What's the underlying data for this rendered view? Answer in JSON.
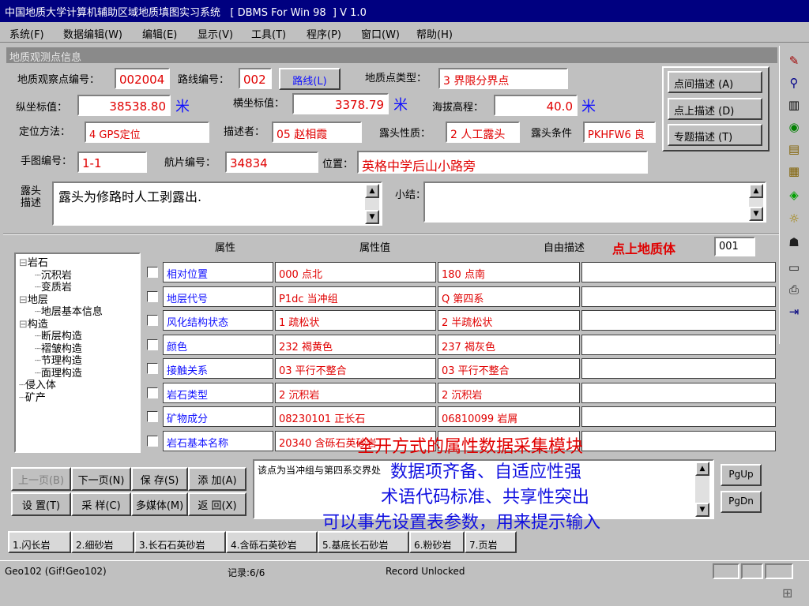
{
  "window": {
    "title": "中国地质大学计算机辅助区域地质填图实习系统   [ DBMS For Win 98  ] V 1.0"
  },
  "menu": [
    "系统(F)",
    "数据编辑(W)",
    "编辑(E)",
    "显示(V)",
    "工具(T)",
    "程序(P)",
    "窗口(W)",
    "帮助(H)"
  ],
  "panel": {
    "header": "地质观测点信息"
  },
  "form": {
    "point_no_label": "地质观察点编号：",
    "point_no": "002004",
    "route_no_label": "路线编号：",
    "route_no": "002",
    "route_button": "路线(L)",
    "point_type_label": "地质点类型：",
    "point_type": "3 界限分界点",
    "y_label": "纵坐标值：",
    "y_value": "38538.80",
    "y_unit": "米",
    "x_label": "横坐标值：",
    "x_value": "3378.79",
    "x_unit": "米",
    "alt_label": "海拔高程：",
    "alt_value": "40.0",
    "alt_unit": "米",
    "method_label": "定位方法：",
    "method": "4 GPS定位",
    "describer_label": "描述者：",
    "describer": "05 赵相霞",
    "outcrop_nature_label": "露头性质：",
    "outcrop_nature": "2 人工露头",
    "outcrop_cond_label": "露头条件",
    "outcrop_cond": "PKHFW6 良",
    "map_no_label": "手图编号：",
    "map_no": "1-1",
    "photo_no_label": "航片编号：",
    "photo_no": "34834",
    "location_label": "位置：",
    "location": "英格中学后山小路旁",
    "outcrop_desc_label": "露头描述",
    "outcrop_desc": "露头为修路时人工剥露出.",
    "summary_label": "小结："
  },
  "side_buttons": [
    "点间描述 (A)",
    "点上描述 (D)",
    "专题描述 (T)"
  ],
  "grid": {
    "headers": {
      "attr": "属性",
      "value": "属性值",
      "free": "自由描述"
    },
    "entity_label": "点上地质体",
    "entity_no": "001",
    "rows": [
      {
        "attr": "相对位置",
        "v1": "000 点北",
        "v2": "180 点南"
      },
      {
        "attr": "地层代号",
        "v1": "P1dc 当冲组",
        "v2": "Q 第四系"
      },
      {
        "attr": "风化结构状态",
        "v1": "1 疏松状",
        "v2": "2 半疏松状"
      },
      {
        "attr": "颜色",
        "v1": "232 褐黄色",
        "v2": "237 褐灰色"
      },
      {
        "attr": "接触关系",
        "v1": "03 平行不整合",
        "v2": "03 平行不整合"
      },
      {
        "attr": "岩石类型",
        "v1": "2 沉积岩",
        "v2": "2 沉积岩"
      },
      {
        "attr": "矿物成分",
        "v1": "08230101 正长石",
        "v2": "06810099 岩屑"
      },
      {
        "attr": "岩石基本名称",
        "v1": "20340 含砾石英砂岩",
        "v2": ""
      }
    ]
  },
  "tree": [
    {
      "text": "岩石",
      "level": 0,
      "exp": "−"
    },
    {
      "text": "沉积岩",
      "level": 1
    },
    {
      "text": "变质岩",
      "level": 1
    },
    {
      "text": "地层",
      "level": 0,
      "exp": "−"
    },
    {
      "text": "地层基本信息",
      "level": 1
    },
    {
      "text": "构造",
      "level": 0,
      "exp": "−"
    },
    {
      "text": "断层构造",
      "level": 1
    },
    {
      "text": "褶皱构造",
      "level": 1
    },
    {
      "text": "节理构造",
      "level": 1
    },
    {
      "text": "面理构造",
      "level": 1
    },
    {
      "text": "侵入体",
      "level": 0
    },
    {
      "text": "矿产",
      "level": 0
    }
  ],
  "nav_buttons": [
    "上一页(B)",
    "下一页(N)",
    "保 存(S)",
    "添 加(A)",
    "设 置(T)",
    "采 样(C)",
    "多媒体(M)",
    "返 回(X)"
  ],
  "note_text": "该点为当冲组与第四系交界处",
  "page_buttons": [
    "PgUp",
    "PgDn"
  ],
  "tabs": [
    "1.闪长岩",
    "2.细砂岩",
    "3.长石石英砂岩",
    "4.含砾石英砂岩",
    "5.基底长石砂岩",
    "6.粉砂岩",
    "7.页岩"
  ],
  "overlay": {
    "line1": "全开方式的属性数据采集模块",
    "line2": "数据项齐备、自适应性强",
    "line3": "术语代码标准、共享性突出",
    "line4": "可以事先设置表参数，用来提示输入"
  },
  "status": {
    "db": "Geo102 (Gif!Geo102)",
    "record": "记录:6/6",
    "lock": "Record Unlocked"
  },
  "colors": {
    "title_bg": "#000080",
    "accent_red": "#e00000",
    "accent_blue": "#1010ff",
    "overlay_red": "#e00000"
  }
}
